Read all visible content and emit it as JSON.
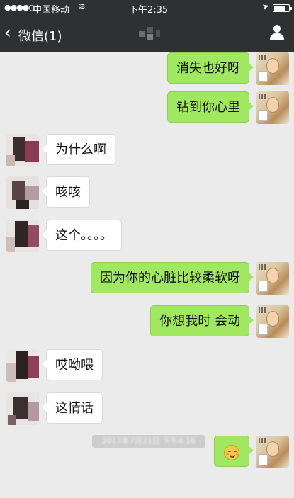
{
  "status": {
    "signal": "●●●●○",
    "carrier": "中国移动",
    "wifi_icon": "wifi-icon",
    "time": "下午2:35",
    "location_icon": "location-arrow-icon",
    "battery": 0.7
  },
  "nav": {
    "back_icon": "chevron-left-icon",
    "back_label": "微信(1)",
    "profile_icon": "person-icon"
  },
  "messages": [
    {
      "side": "right",
      "text": "消失也好呀"
    },
    {
      "side": "right",
      "text": "钻到你心里"
    },
    {
      "side": "left",
      "text": "为什么啊"
    },
    {
      "side": "left",
      "text": "咳咳"
    },
    {
      "side": "left",
      "text": "这个。。。。"
    },
    {
      "side": "right",
      "text": "因为你的心脏比较柔软呀"
    },
    {
      "side": "right",
      "text": "你想我时 会动"
    },
    {
      "side": "left",
      "text": "哎呦喂"
    },
    {
      "side": "left",
      "text": "这情话"
    },
    {
      "side": "right",
      "emoji": "smiling-blush-emoji"
    }
  ],
  "timestamp": "2017年7月21日 下午4:16",
  "colors": {
    "bar": "#2e3132",
    "bubble_right": "#9fe85f",
    "bubble_left": "#ffffff",
    "background": "#ebebeb"
  }
}
